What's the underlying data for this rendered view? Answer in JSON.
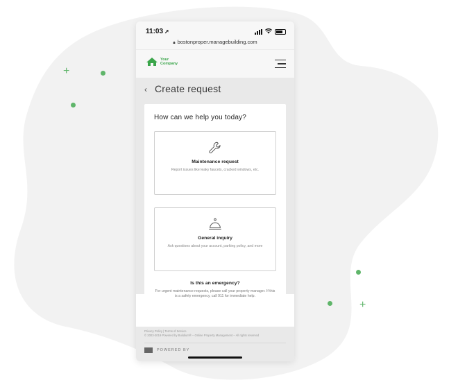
{
  "status_bar": {
    "time": "11:03",
    "location_glyph": "➚",
    "url": "bostonproper.managebuilding.com"
  },
  "header": {
    "logo_line1": "Your",
    "logo_line2": "Company",
    "logo_icon": "house-icon",
    "menu_icon": "hamburger-icon"
  },
  "page": {
    "back_glyph": "‹",
    "title": "Create request"
  },
  "card": {
    "heading": "How can we help you today?",
    "options": [
      {
        "icon": "wrench-icon",
        "title": "Maintenance request",
        "description": "Report issues like leaky faucets, cracked windows, etc."
      },
      {
        "icon": "service-bell-icon",
        "title": "General inquiry",
        "description": "Ask questions about your account, parking policy, and more"
      }
    ],
    "emergency": {
      "title": "Is this an emergency?",
      "text": "For urgent maintenance requests, please call your property manager. If this is a safety emergency, call 911 for immediate help."
    }
  },
  "footer": {
    "links": "Privacy Policy | Terms of Service",
    "copyright": "© 2003-2019 Powered by Buildium® – Online Property Management – All rights reserved",
    "powered": "POWERED BY"
  },
  "colors": {
    "accent_green": "#5fb56a",
    "background_blob": "#f2f2f2",
    "phone_gray": "#e9e9e9"
  }
}
